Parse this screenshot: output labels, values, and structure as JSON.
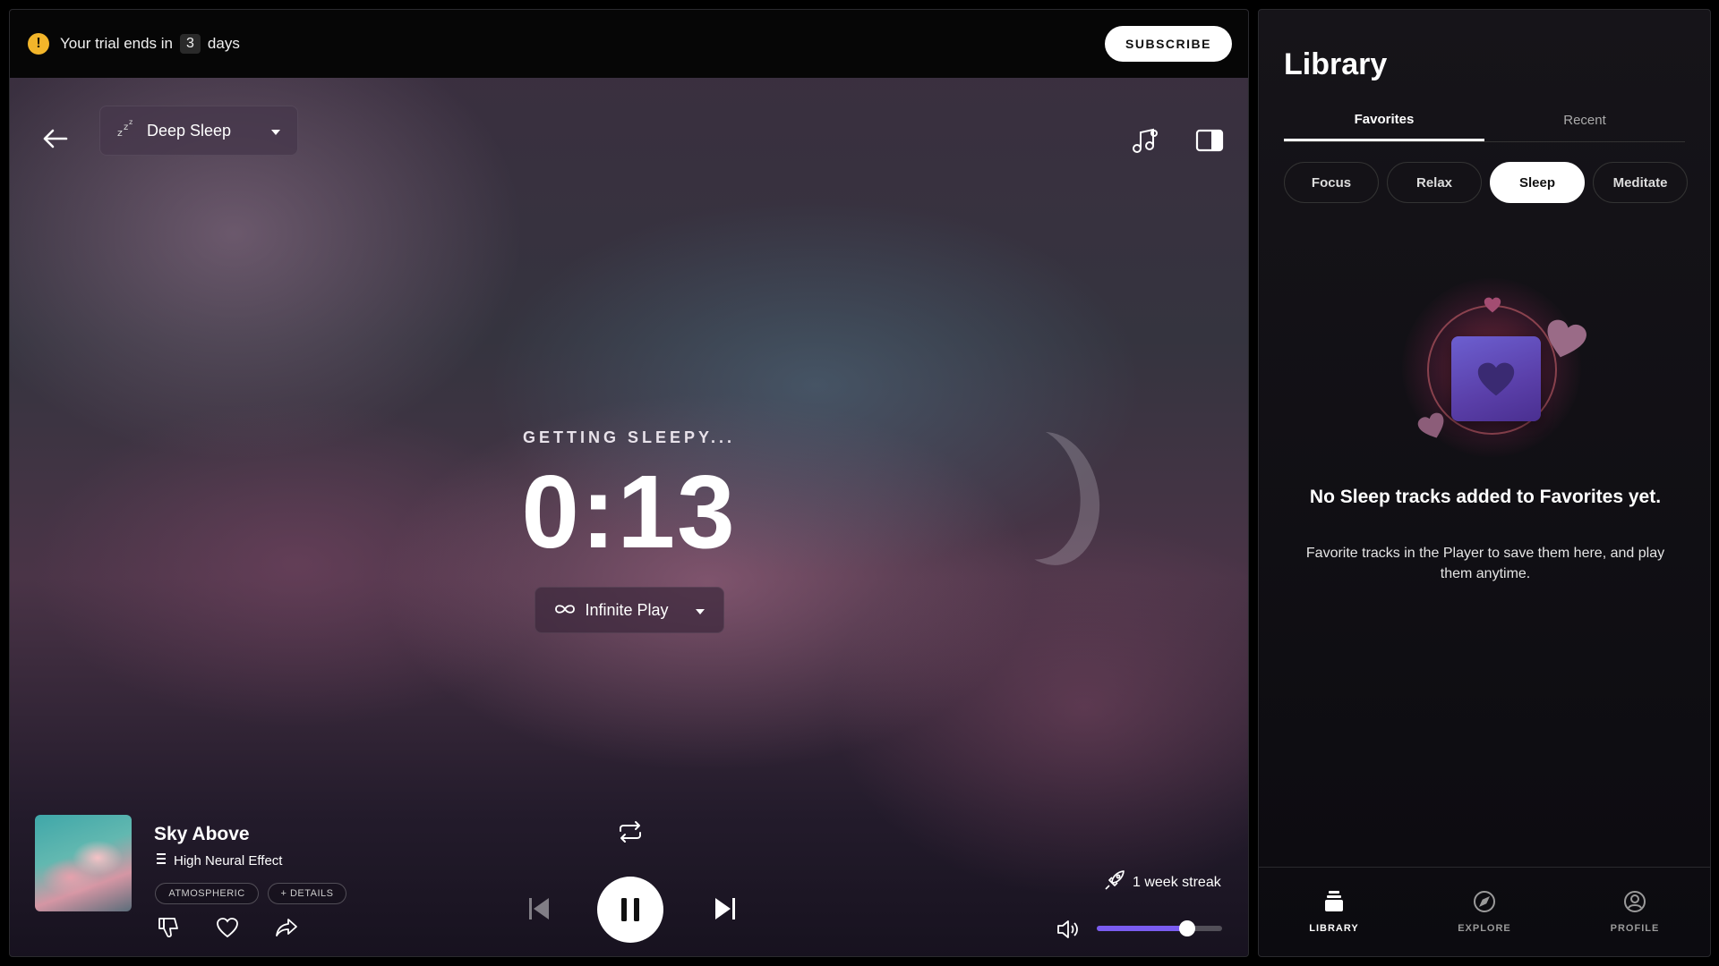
{
  "trial": {
    "prefix": "Your trial ends in",
    "days": "3",
    "suffix": "days",
    "subscribe_label": "SUBSCRIBE"
  },
  "player": {
    "mode": "Deep Sleep",
    "status_label": "GETTING SLEEPY...",
    "timer": "0:13",
    "play_mode": "Infinite Play",
    "track": {
      "title": "Sky Above",
      "effect": "High Neural Effect",
      "tags": [
        "ATMOSPHERIC",
        "+ DETAILS"
      ]
    },
    "streak": "1 week streak",
    "volume_percent": 72,
    "is_playing": true
  },
  "library": {
    "title": "Library",
    "tabs": [
      {
        "label": "Favorites",
        "active": true
      },
      {
        "label": "Recent",
        "active": false
      }
    ],
    "filters": [
      {
        "label": "Focus",
        "active": false
      },
      {
        "label": "Relax",
        "active": false
      },
      {
        "label": "Sleep",
        "active": true
      },
      {
        "label": "Meditate",
        "active": false
      }
    ],
    "empty_title": "No Sleep tracks added to Favorites yet.",
    "empty_subtitle": "Favorite tracks in the Player to save them here, and play them anytime."
  },
  "nav": [
    {
      "label": "LIBRARY",
      "icon": "library-icon",
      "active": true
    },
    {
      "label": "EXPLORE",
      "icon": "compass-icon",
      "active": false
    },
    {
      "label": "PROFILE",
      "icon": "profile-icon",
      "active": false
    }
  ],
  "colors": {
    "accent": "#7a5cf0",
    "warning": "#f2b52a"
  }
}
